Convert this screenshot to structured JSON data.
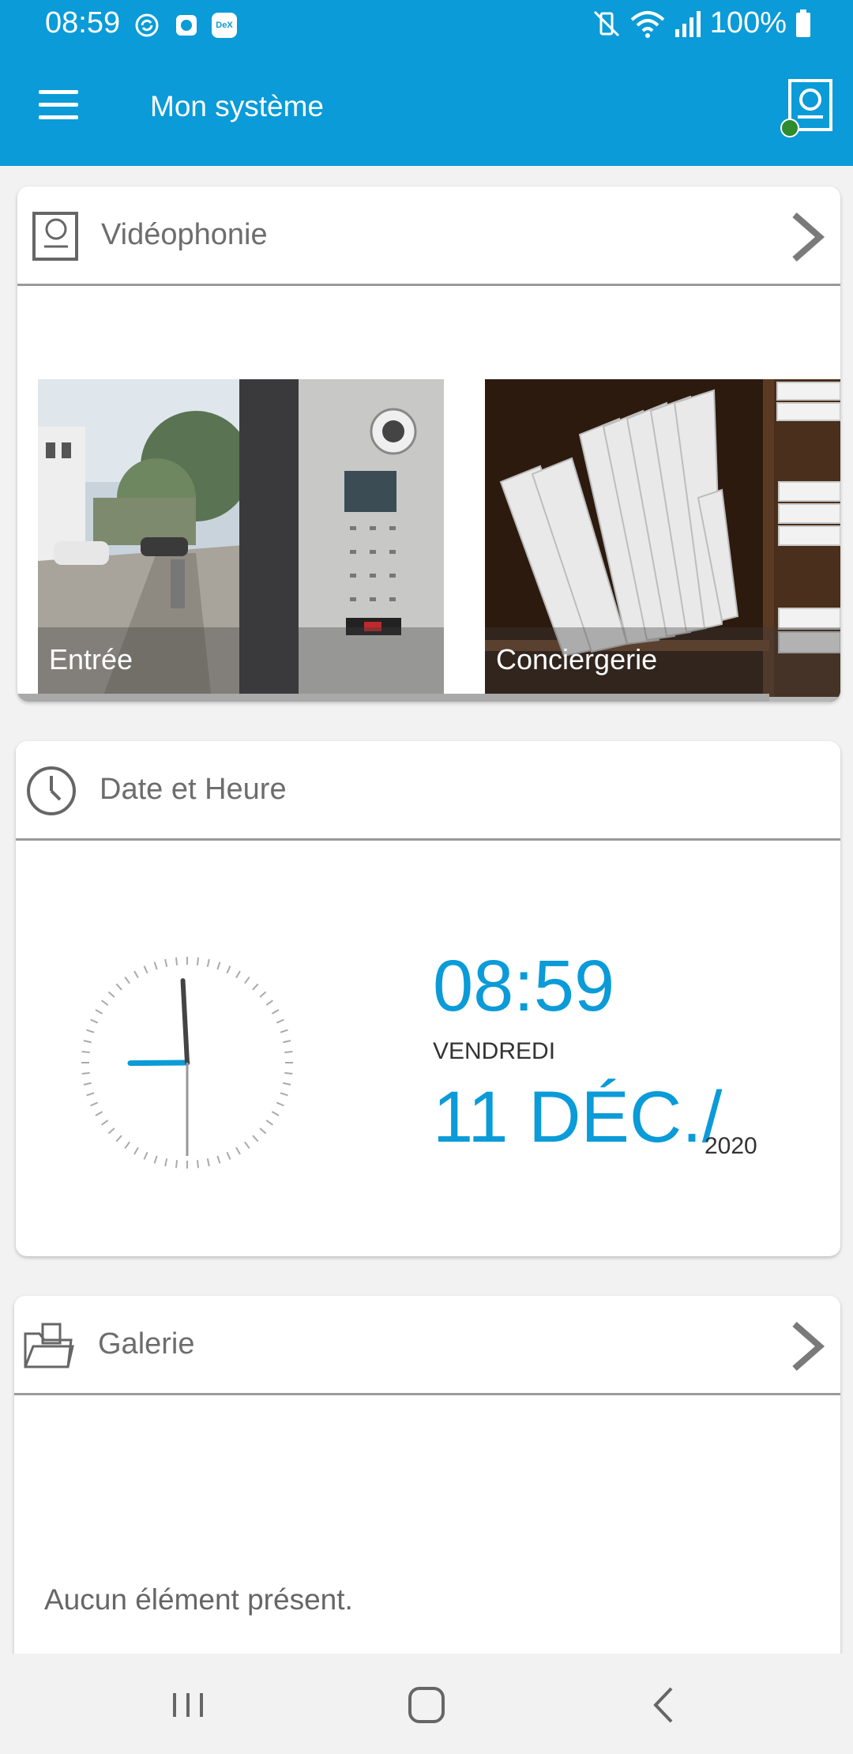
{
  "status_bar": {
    "time": "08:59",
    "battery_text": "100%",
    "notification_icons": [
      "sync-icon",
      "app-icon",
      "dex-icon"
    ],
    "dex_label": "DeX"
  },
  "app_bar": {
    "title": "Mon système",
    "menu_icon": "hamburger-icon",
    "device_icon": "intercom-status-icon",
    "status_color": "#2e8b2e"
  },
  "videophonie": {
    "title": "Vidéophonie",
    "tiles": [
      {
        "label": "Entrée"
      },
      {
        "label": "Conciergerie"
      }
    ]
  },
  "datetime": {
    "title": "Date et Heure",
    "time": "08:59",
    "weekday": "VENDREDI",
    "date": "11 DÉC./",
    "year": "2020",
    "hour": 8,
    "minute": 59,
    "second": 30
  },
  "galerie": {
    "title": "Galerie",
    "empty_text": "Aucun élément présent."
  },
  "colors": {
    "accent": "#0a9bd8",
    "header_text": "#6d6d6d"
  }
}
